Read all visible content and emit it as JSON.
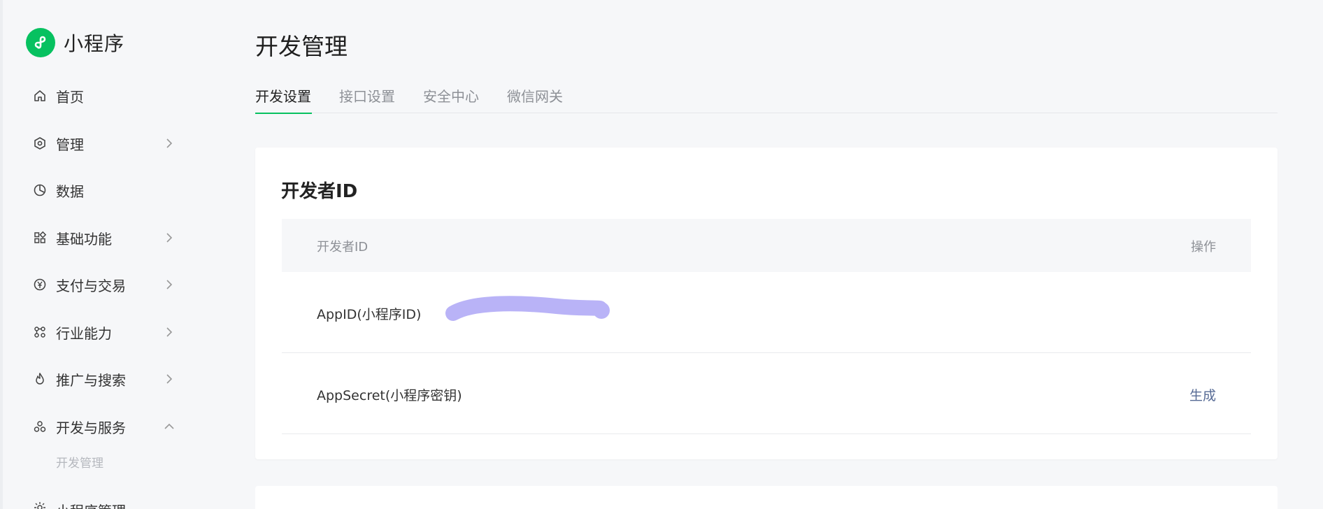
{
  "brand": {
    "name": "小程序",
    "logo_icon": "miniprogram-logo-icon",
    "color": "#07c160"
  },
  "sidebar": {
    "items": [
      {
        "label": "首页",
        "icon": "home-icon",
        "chevron": "none"
      },
      {
        "label": "管理",
        "icon": "hexagon-icon",
        "chevron": "right"
      },
      {
        "label": "数据",
        "icon": "pie-chart-icon",
        "chevron": "none"
      },
      {
        "label": "基础功能",
        "icon": "grid-icon",
        "chevron": "right"
      },
      {
        "label": "支付与交易",
        "icon": "yen-icon",
        "chevron": "right"
      },
      {
        "label": "行业能力",
        "icon": "industry-icon",
        "chevron": "right"
      },
      {
        "label": "推广与搜索",
        "icon": "flame-icon",
        "chevron": "right"
      },
      {
        "label": "开发与服务",
        "icon": "cluster-icon",
        "chevron": "up"
      }
    ],
    "sub_item": "开发管理",
    "partial_item": {
      "label": "小程序管理",
      "icon": "sun-icon"
    }
  },
  "main": {
    "title": "开发管理",
    "tabs": [
      {
        "label": "开发设置",
        "active": true
      },
      {
        "label": "接口设置",
        "active": false
      },
      {
        "label": "安全中心",
        "active": false
      },
      {
        "label": "微信网关",
        "active": false
      }
    ],
    "accent": "#07c160"
  },
  "developer_card": {
    "title": "开发者ID",
    "columns": {
      "name": "开发者ID",
      "action": "操作"
    },
    "rows": [
      {
        "name": "AppID(小程序ID)",
        "value_redacted": true,
        "action": ""
      },
      {
        "name": "AppSecret(小程序密钥)",
        "action": "生成"
      }
    ],
    "link_color": "#576b95",
    "redaction_color": "#b9b3f7"
  }
}
